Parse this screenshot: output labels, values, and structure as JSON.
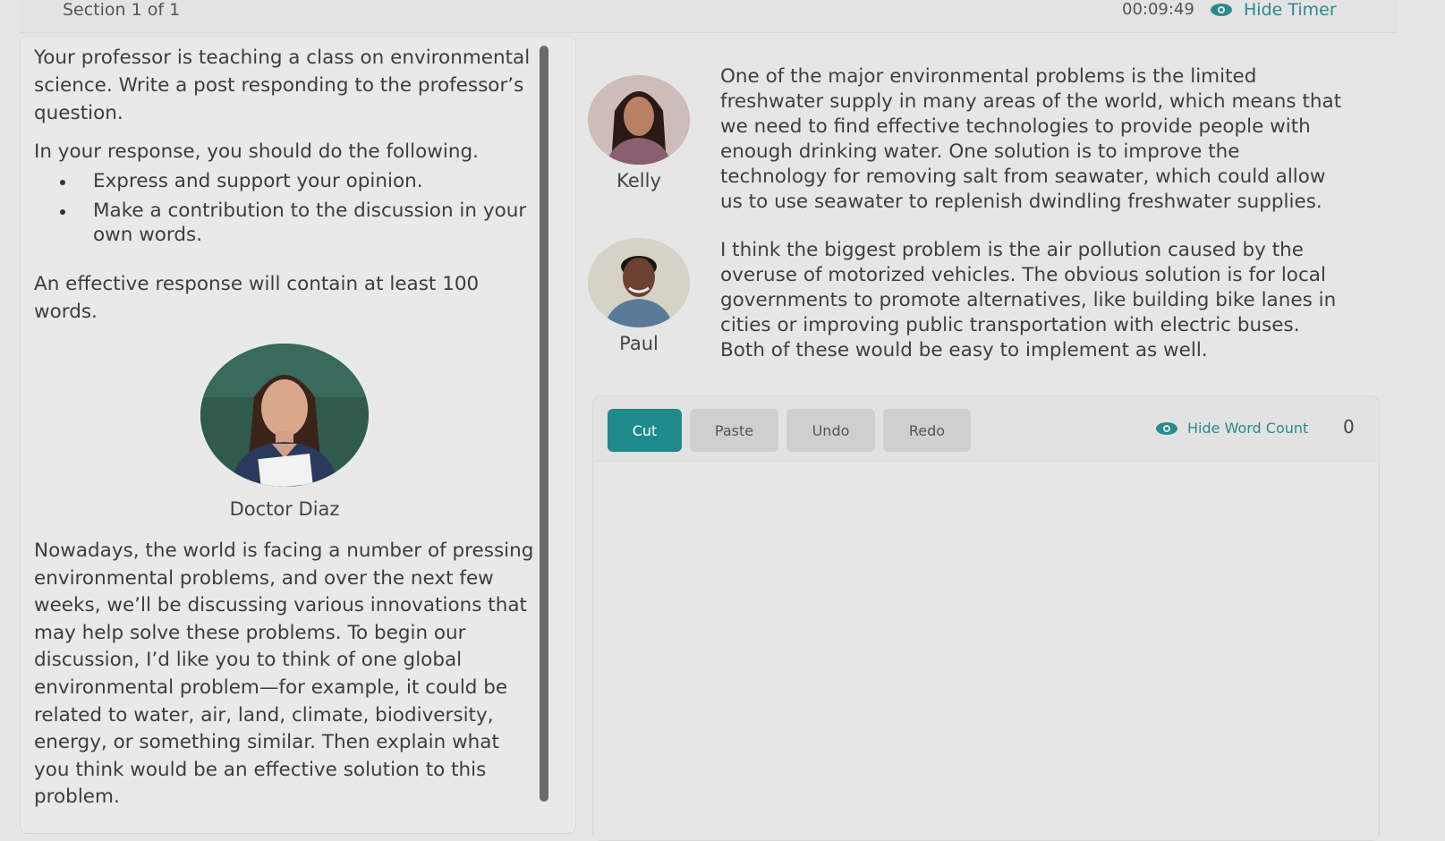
{
  "header": {
    "section": "Section 1 of 1",
    "timer": "00:09:49",
    "hide_timer_label": "Hide Timer"
  },
  "prompt": {
    "intro": "Your professor is teaching a class on environmental science. Write a post responding to the professor’s question.",
    "instruction": "In your response, you should do the following.",
    "bullets": [
      "Express and support your opinion.",
      "Make a contribution to the discussion in your own words."
    ],
    "length_note": "An effective response will contain at least 100 words."
  },
  "professor": {
    "name": "Doctor Diaz",
    "question": "Nowadays, the world is facing a number of pressing environmental problems, and over the next few weeks, we’ll be discussing various innovations that may help solve these problems. To begin our discussion, I’d like you to think of one global environmental problem—for example, it could be related to water, air, land, climate, biodiversity, energy, or something similar. Then explain what you think would be an effective solution to this problem."
  },
  "posts": [
    {
      "name": "Kelly",
      "text": "One of the major environmental problems is the limited freshwater supply in many areas of the world, which means that we need to find effective technologies to provide people with enough drinking water. One solution is to improve the technology for removing salt from seawater, which could allow us to use seawater to replenish dwindling freshwater supplies."
    },
    {
      "name": "Paul",
      "text": "I think the biggest problem is the air pollution caused by the overuse of motorized vehicles. The obvious solution is for local governments to promote alternatives, like building bike lanes in cities or improving public transportation with electric buses. Both of these would be easy to implement as well."
    }
  ],
  "editor": {
    "buttons": {
      "cut": "Cut",
      "paste": "Paste",
      "undo": "Undo",
      "redo": "Redo"
    },
    "hide_word_count_label": "Hide Word Count",
    "word_count": "0",
    "content": ""
  },
  "colors": {
    "accent": "#1f8a8c",
    "link": "#2a8a8f",
    "background": "#e6e6e6"
  }
}
